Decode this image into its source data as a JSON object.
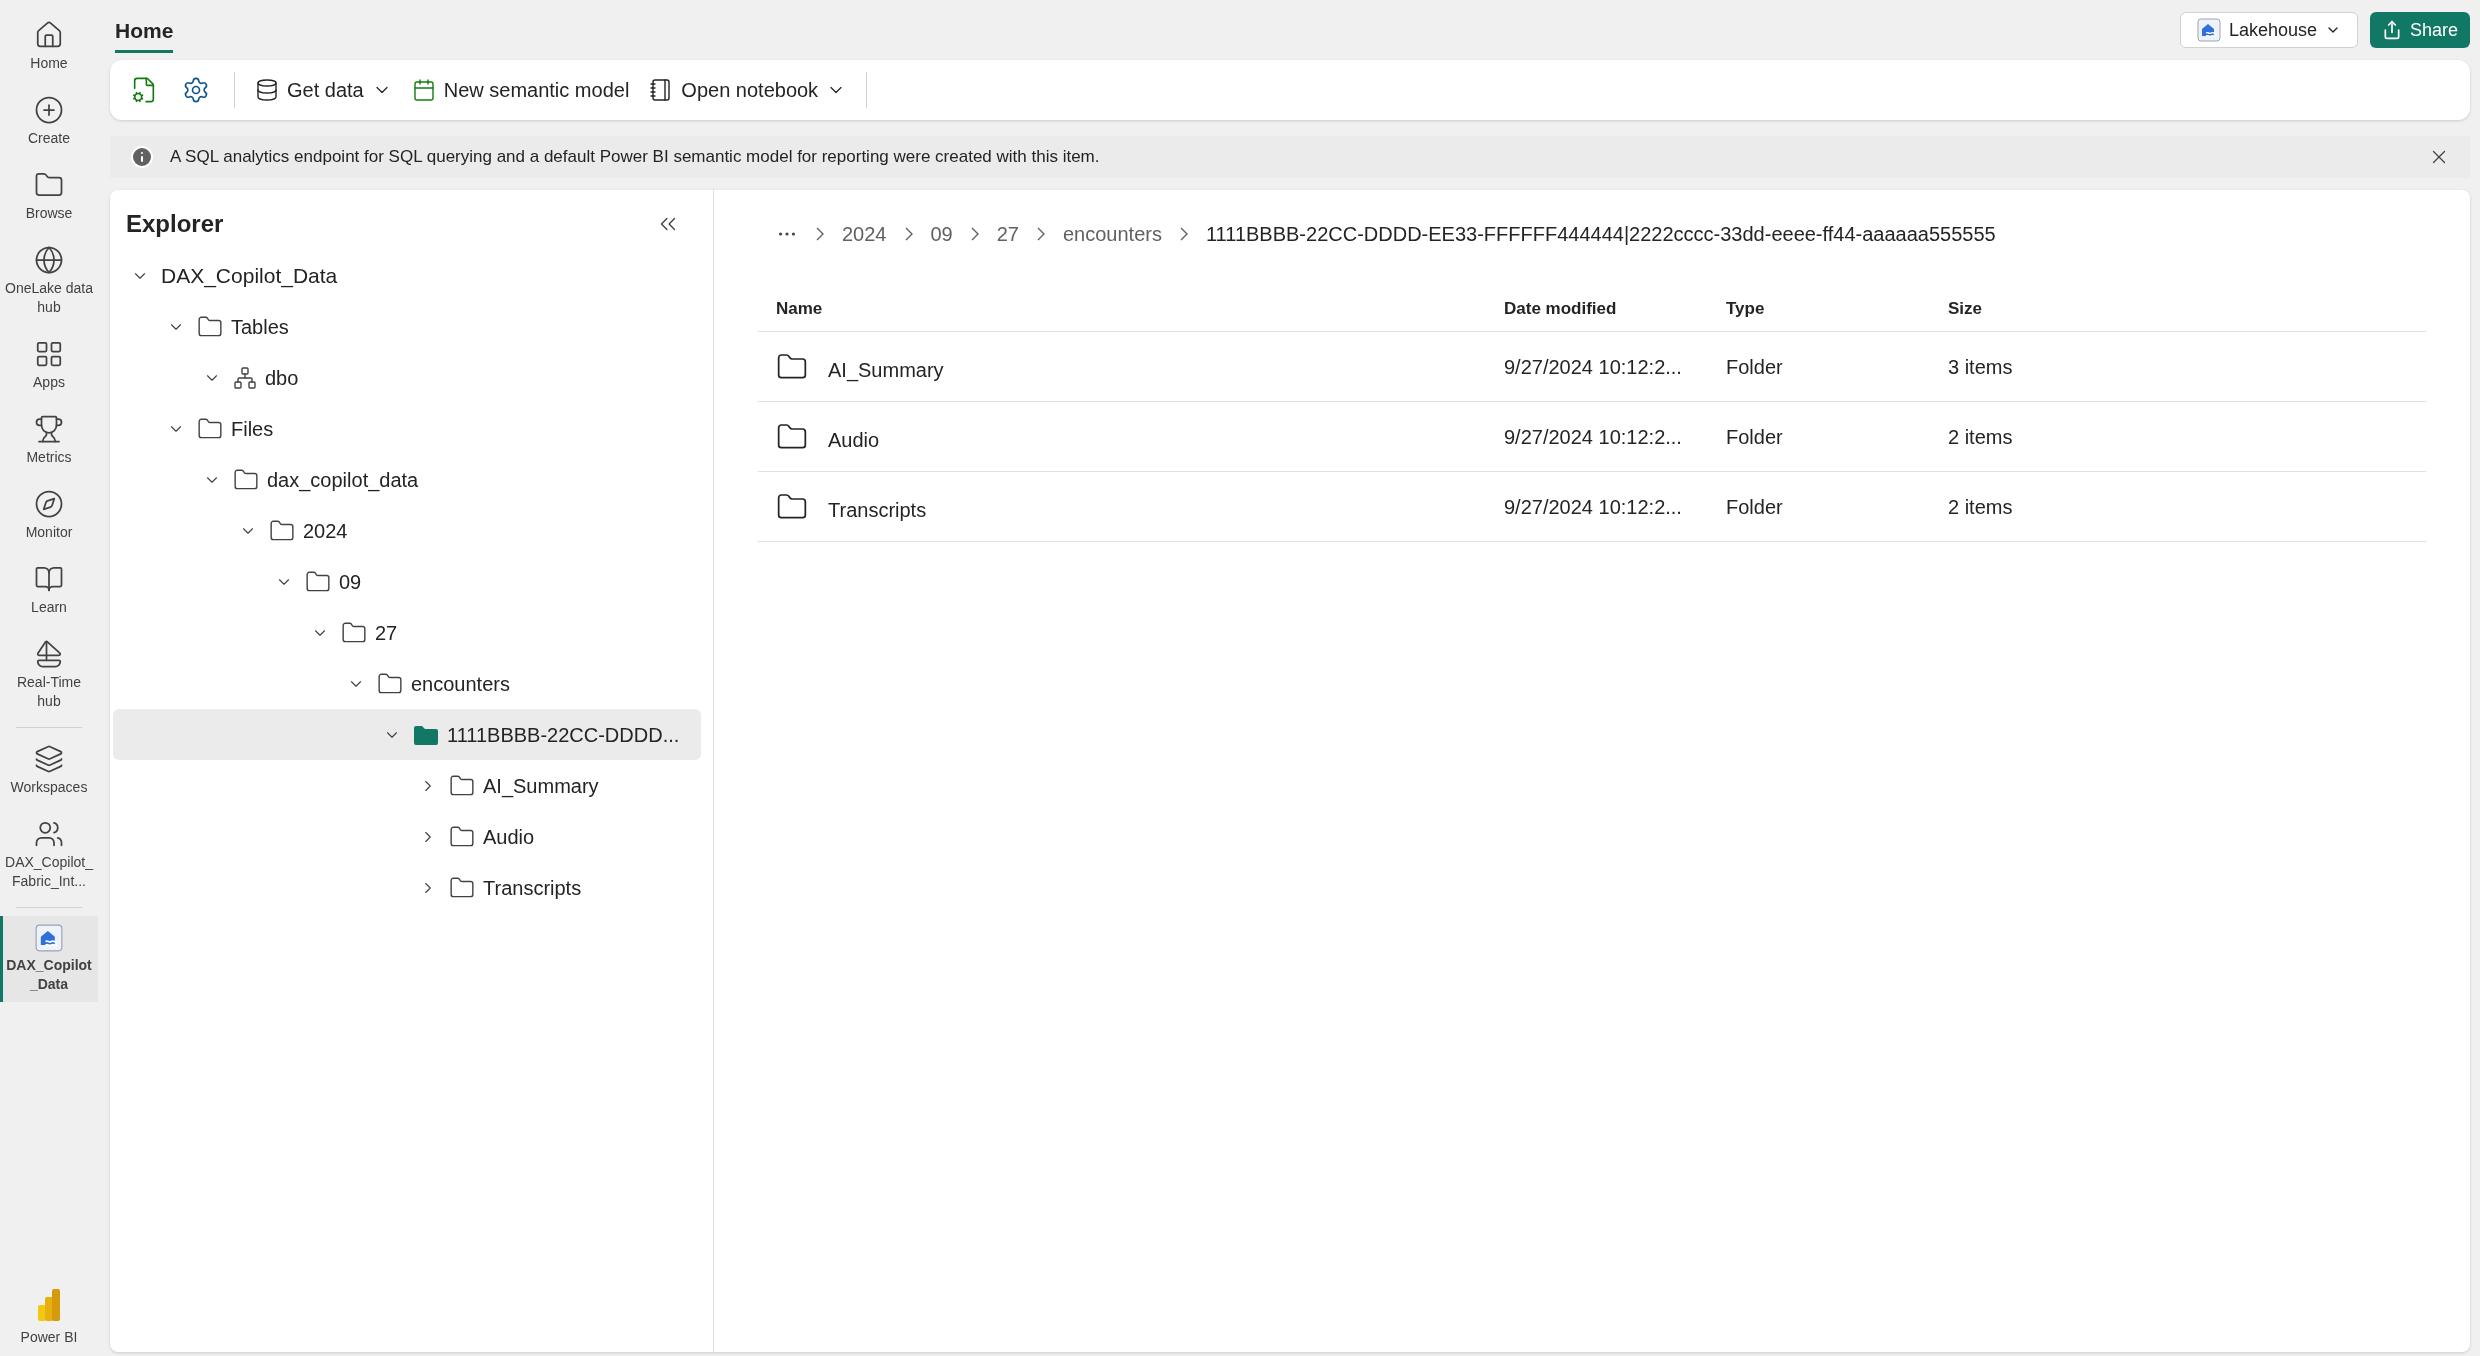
{
  "nav": {
    "items": [
      {
        "label": "Home",
        "selected": false
      },
      {
        "label": "Create",
        "selected": false
      },
      {
        "label": "Browse",
        "selected": false
      },
      {
        "label": "OneLake data hub",
        "selected": false
      },
      {
        "label": "Apps",
        "selected": false
      },
      {
        "label": "Metrics",
        "selected": false
      },
      {
        "label": "Monitor",
        "selected": false
      },
      {
        "label": "Learn",
        "selected": false
      },
      {
        "label": "Real-Time hub",
        "selected": false
      }
    ],
    "workspaces": [
      {
        "label": "Workspaces",
        "selected": false
      },
      {
        "label": "DAX_Copilot_Fabric_Int...",
        "selected": false
      }
    ],
    "open_items": [
      {
        "label": "DAX_Copilot_Data",
        "selected": true
      }
    ],
    "footer": {
      "label": "Power BI"
    }
  },
  "ribbon": {
    "tabs": [
      {
        "label": "Home",
        "selected": true
      }
    ],
    "buttons": [
      {
        "label": "Get data",
        "dropdown": true
      },
      {
        "label": "New semantic model",
        "dropdown": false
      },
      {
        "label": "Open notebook",
        "dropdown": true
      }
    ]
  },
  "header": {
    "item_type": "Lakehouse",
    "share": "Share"
  },
  "info_bar": {
    "text": "A SQL analytics endpoint for SQL querying and a default Power BI semantic model for reporting were created with this item."
  },
  "explorer": {
    "title": "Explorer",
    "tree": [
      {
        "label": "DAX_Copilot_Data",
        "kind": "root",
        "expanded": true,
        "selected": false,
        "children": [
          {
            "label": "Tables",
            "kind": "folder",
            "expanded": true,
            "selected": false,
            "children": [
              {
                "label": "dbo",
                "kind": "schema",
                "expanded": true,
                "selected": false
              }
            ]
          },
          {
            "label": "Files",
            "kind": "folder",
            "expanded": true,
            "selected": false,
            "children": [
              {
                "label": "dax_copilot_data",
                "kind": "folder",
                "expanded": true,
                "selected": false,
                "children": [
                  {
                    "label": "2024",
                    "kind": "folder",
                    "expanded": true,
                    "selected": false,
                    "children": [
                      {
                        "label": "09",
                        "kind": "folder",
                        "expanded": true,
                        "selected": false,
                        "children": [
                          {
                            "label": "27",
                            "kind": "folder",
                            "expanded": true,
                            "selected": false,
                            "children": [
                              {
                                "label": "encounters",
                                "kind": "folder",
                                "expanded": true,
                                "selected": false,
                                "children": [
                                  {
                                    "label": "1111BBBB-22CC-DDDD...",
                                    "kind": "folder",
                                    "expanded": true,
                                    "selected": true,
                                    "children": [
                                      {
                                        "label": "AI_Summary",
                                        "kind": "folder",
                                        "expanded": false,
                                        "selected": false
                                      },
                                      {
                                        "label": "Audio",
                                        "kind": "folder",
                                        "expanded": false,
                                        "selected": false
                                      },
                                      {
                                        "label": "Transcripts",
                                        "kind": "folder",
                                        "expanded": false,
                                        "selected": false
                                      }
                                    ]
                                  }
                                ]
                              }
                            ]
                          }
                        ]
                      }
                    ]
                  }
                ]
              }
            ]
          }
        ]
      }
    ]
  },
  "content": {
    "breadcrumb": [
      {
        "label": "2024",
        "selected": false
      },
      {
        "label": "09",
        "selected": false
      },
      {
        "label": "27",
        "selected": false
      },
      {
        "label": "encounters",
        "selected": false
      },
      {
        "label": "1111BBBB-22CC-DDDD-EE33-FFFFFF444444|2222cccc-33dd-eeee-ff44-aaaaaa555555",
        "selected": true
      }
    ],
    "table": {
      "columns": [
        "Name",
        "Date modified",
        "Type",
        "Size"
      ],
      "rows": [
        {
          "name": "AI_Summary",
          "date_modified": "9/27/2024 10:12:2...",
          "type": "Folder",
          "size": "3 items"
        },
        {
          "name": "Audio",
          "date_modified": "9/27/2024 10:12:2...",
          "type": "Folder",
          "size": "2 items"
        },
        {
          "name": "Transcripts",
          "date_modified": "9/27/2024 10:12:2...",
          "type": "Folder",
          "size": "2 items"
        }
      ]
    }
  }
}
